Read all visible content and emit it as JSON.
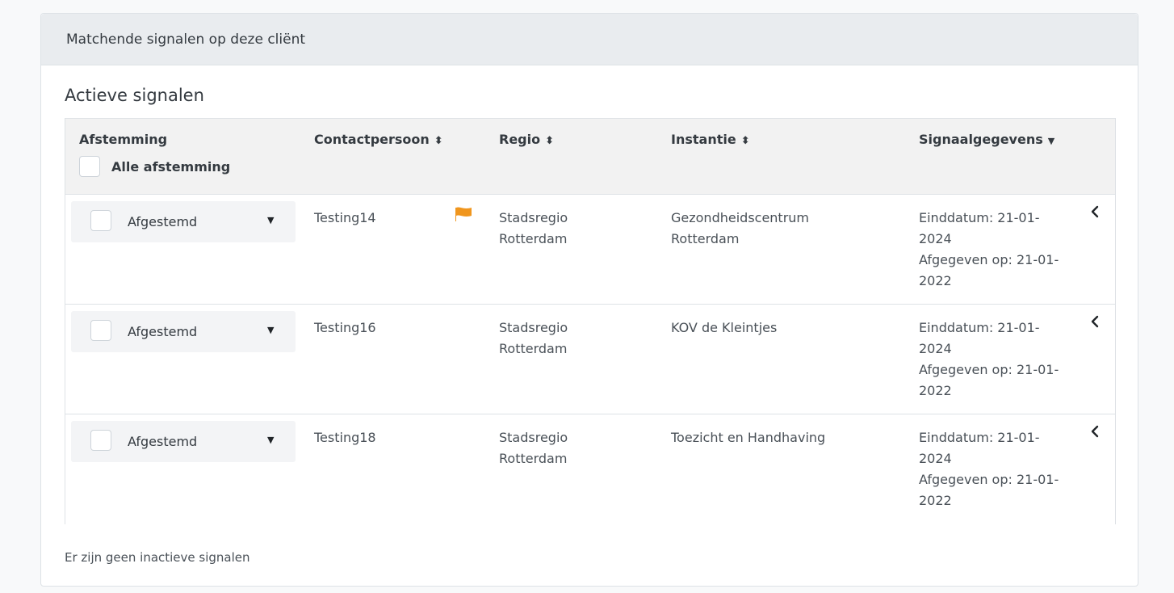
{
  "card": {
    "header_title": "Matchende signalen op deze cliënt",
    "section_title": "Actieve signalen",
    "footer_text": "Er zijn geen inactieve signalen"
  },
  "table": {
    "headers": {
      "afstemming": "Afstemming",
      "alle_afstemming": "Alle afstemming",
      "contactpersoon": "Contactpersoon",
      "regio": "Regio",
      "instantie": "Instantie",
      "signaalgegevens": "Signaalgegevens"
    },
    "rows": [
      {
        "afstemming": "Afgestemd",
        "contactpersoon": "Testing14",
        "flagged": true,
        "regio_line1": "Stadsregio",
        "regio_line2": "Rotterdam",
        "instantie_line1": "Gezondheidscentrum",
        "instantie_line2": "Rotterdam",
        "einddatum_line1": "Einddatum: 21-01-",
        "einddatum_line2": "2024",
        "afgegeven_line1": "Afgegeven op: 21-01-",
        "afgegeven_line2": "2022"
      },
      {
        "afstemming": "Afgestemd",
        "contactpersoon": "Testing16",
        "flagged": false,
        "regio_line1": "Stadsregio",
        "regio_line2": "Rotterdam",
        "instantie_line1": "KOV de Kleintjes",
        "instantie_line2": "",
        "einddatum_line1": "Einddatum: 21-01-",
        "einddatum_line2": "2024",
        "afgegeven_line1": "Afgegeven op: 21-01-",
        "afgegeven_line2": "2022"
      },
      {
        "afstemming": "Afgestemd",
        "contactpersoon": "Testing18",
        "flagged": false,
        "regio_line1": "Stadsregio",
        "regio_line2": "Rotterdam",
        "instantie_line1": "Toezicht en Handhaving",
        "instantie_line2": "",
        "einddatum_line1": "Einddatum: 21-01-",
        "einddatum_line2": "2024",
        "afgegeven_line1": "Afgegeven op: 21-01-",
        "afgegeven_line2": "2022"
      }
    ]
  },
  "icons": {
    "sort": "sort-icon",
    "sort_down": "caret-down-icon",
    "dropdown": "caret-down-icon",
    "flag": "flag-icon",
    "expand": "chevron-left-icon"
  },
  "colors": {
    "flag": "#f0961e",
    "header_bg": "#e9ecef",
    "table_header_bg": "#f2f2f2"
  }
}
